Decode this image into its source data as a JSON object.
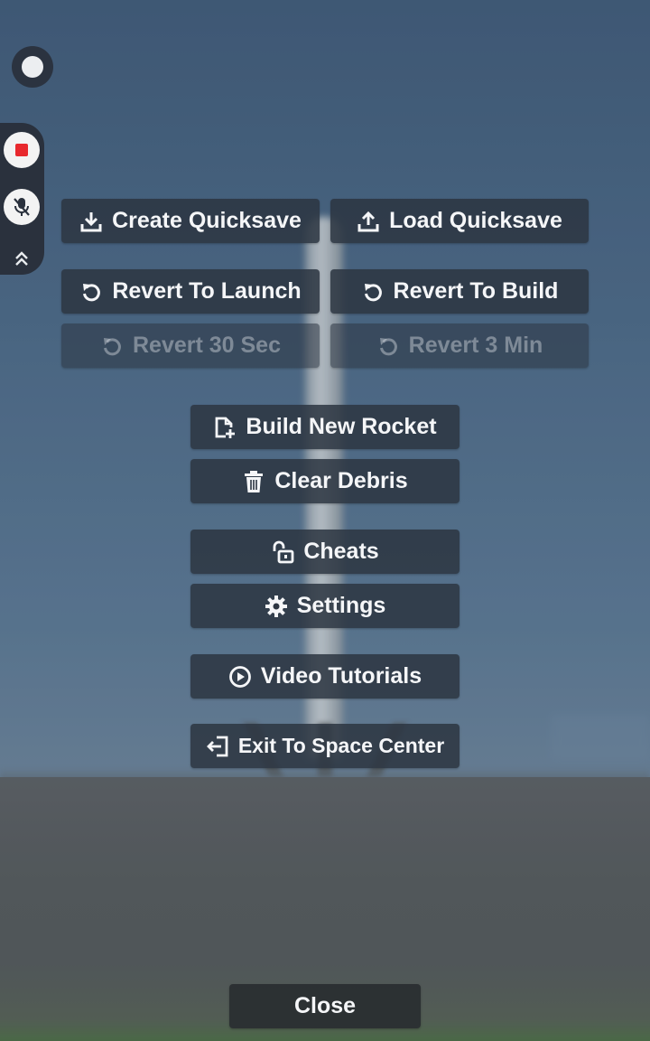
{
  "menu": {
    "create_quicksave": {
      "label": "Create Quicksave",
      "icon": "download-icon"
    },
    "load_quicksave": {
      "label": "Load Quicksave",
      "icon": "upload-icon"
    },
    "revert_to_launch": {
      "label": "Revert To Launch",
      "icon": "revert-icon"
    },
    "revert_to_build": {
      "label": "Revert To Build",
      "icon": "revert-icon"
    },
    "revert_30_sec": {
      "label": "Revert 30 Sec",
      "icon": "revert-icon",
      "enabled": false
    },
    "revert_3_min": {
      "label": "Revert 3 Min",
      "icon": "revert-icon",
      "enabled": false
    },
    "build_new_rocket": {
      "label": "Build New Rocket",
      "icon": "new-file-icon"
    },
    "clear_debris": {
      "label": "Clear Debris",
      "icon": "trash-icon"
    },
    "cheats": {
      "label": "Cheats",
      "icon": "unlock-icon"
    },
    "settings": {
      "label": "Settings",
      "icon": "gear-icon"
    },
    "video_tutorials": {
      "label": "Video Tutorials",
      "icon": "play-circle-icon"
    },
    "exit_to_space_center": {
      "label": "Exit To Space Center",
      "icon": "exit-icon"
    }
  },
  "close": {
    "label": "Close"
  },
  "recorder": {
    "assistive_dot": "assistive-touch-icon",
    "stop": "stop-record-icon",
    "mic": "mic-muted-icon",
    "collapse": "chevron-double-up-icon",
    "record_color": "#e8282d"
  }
}
